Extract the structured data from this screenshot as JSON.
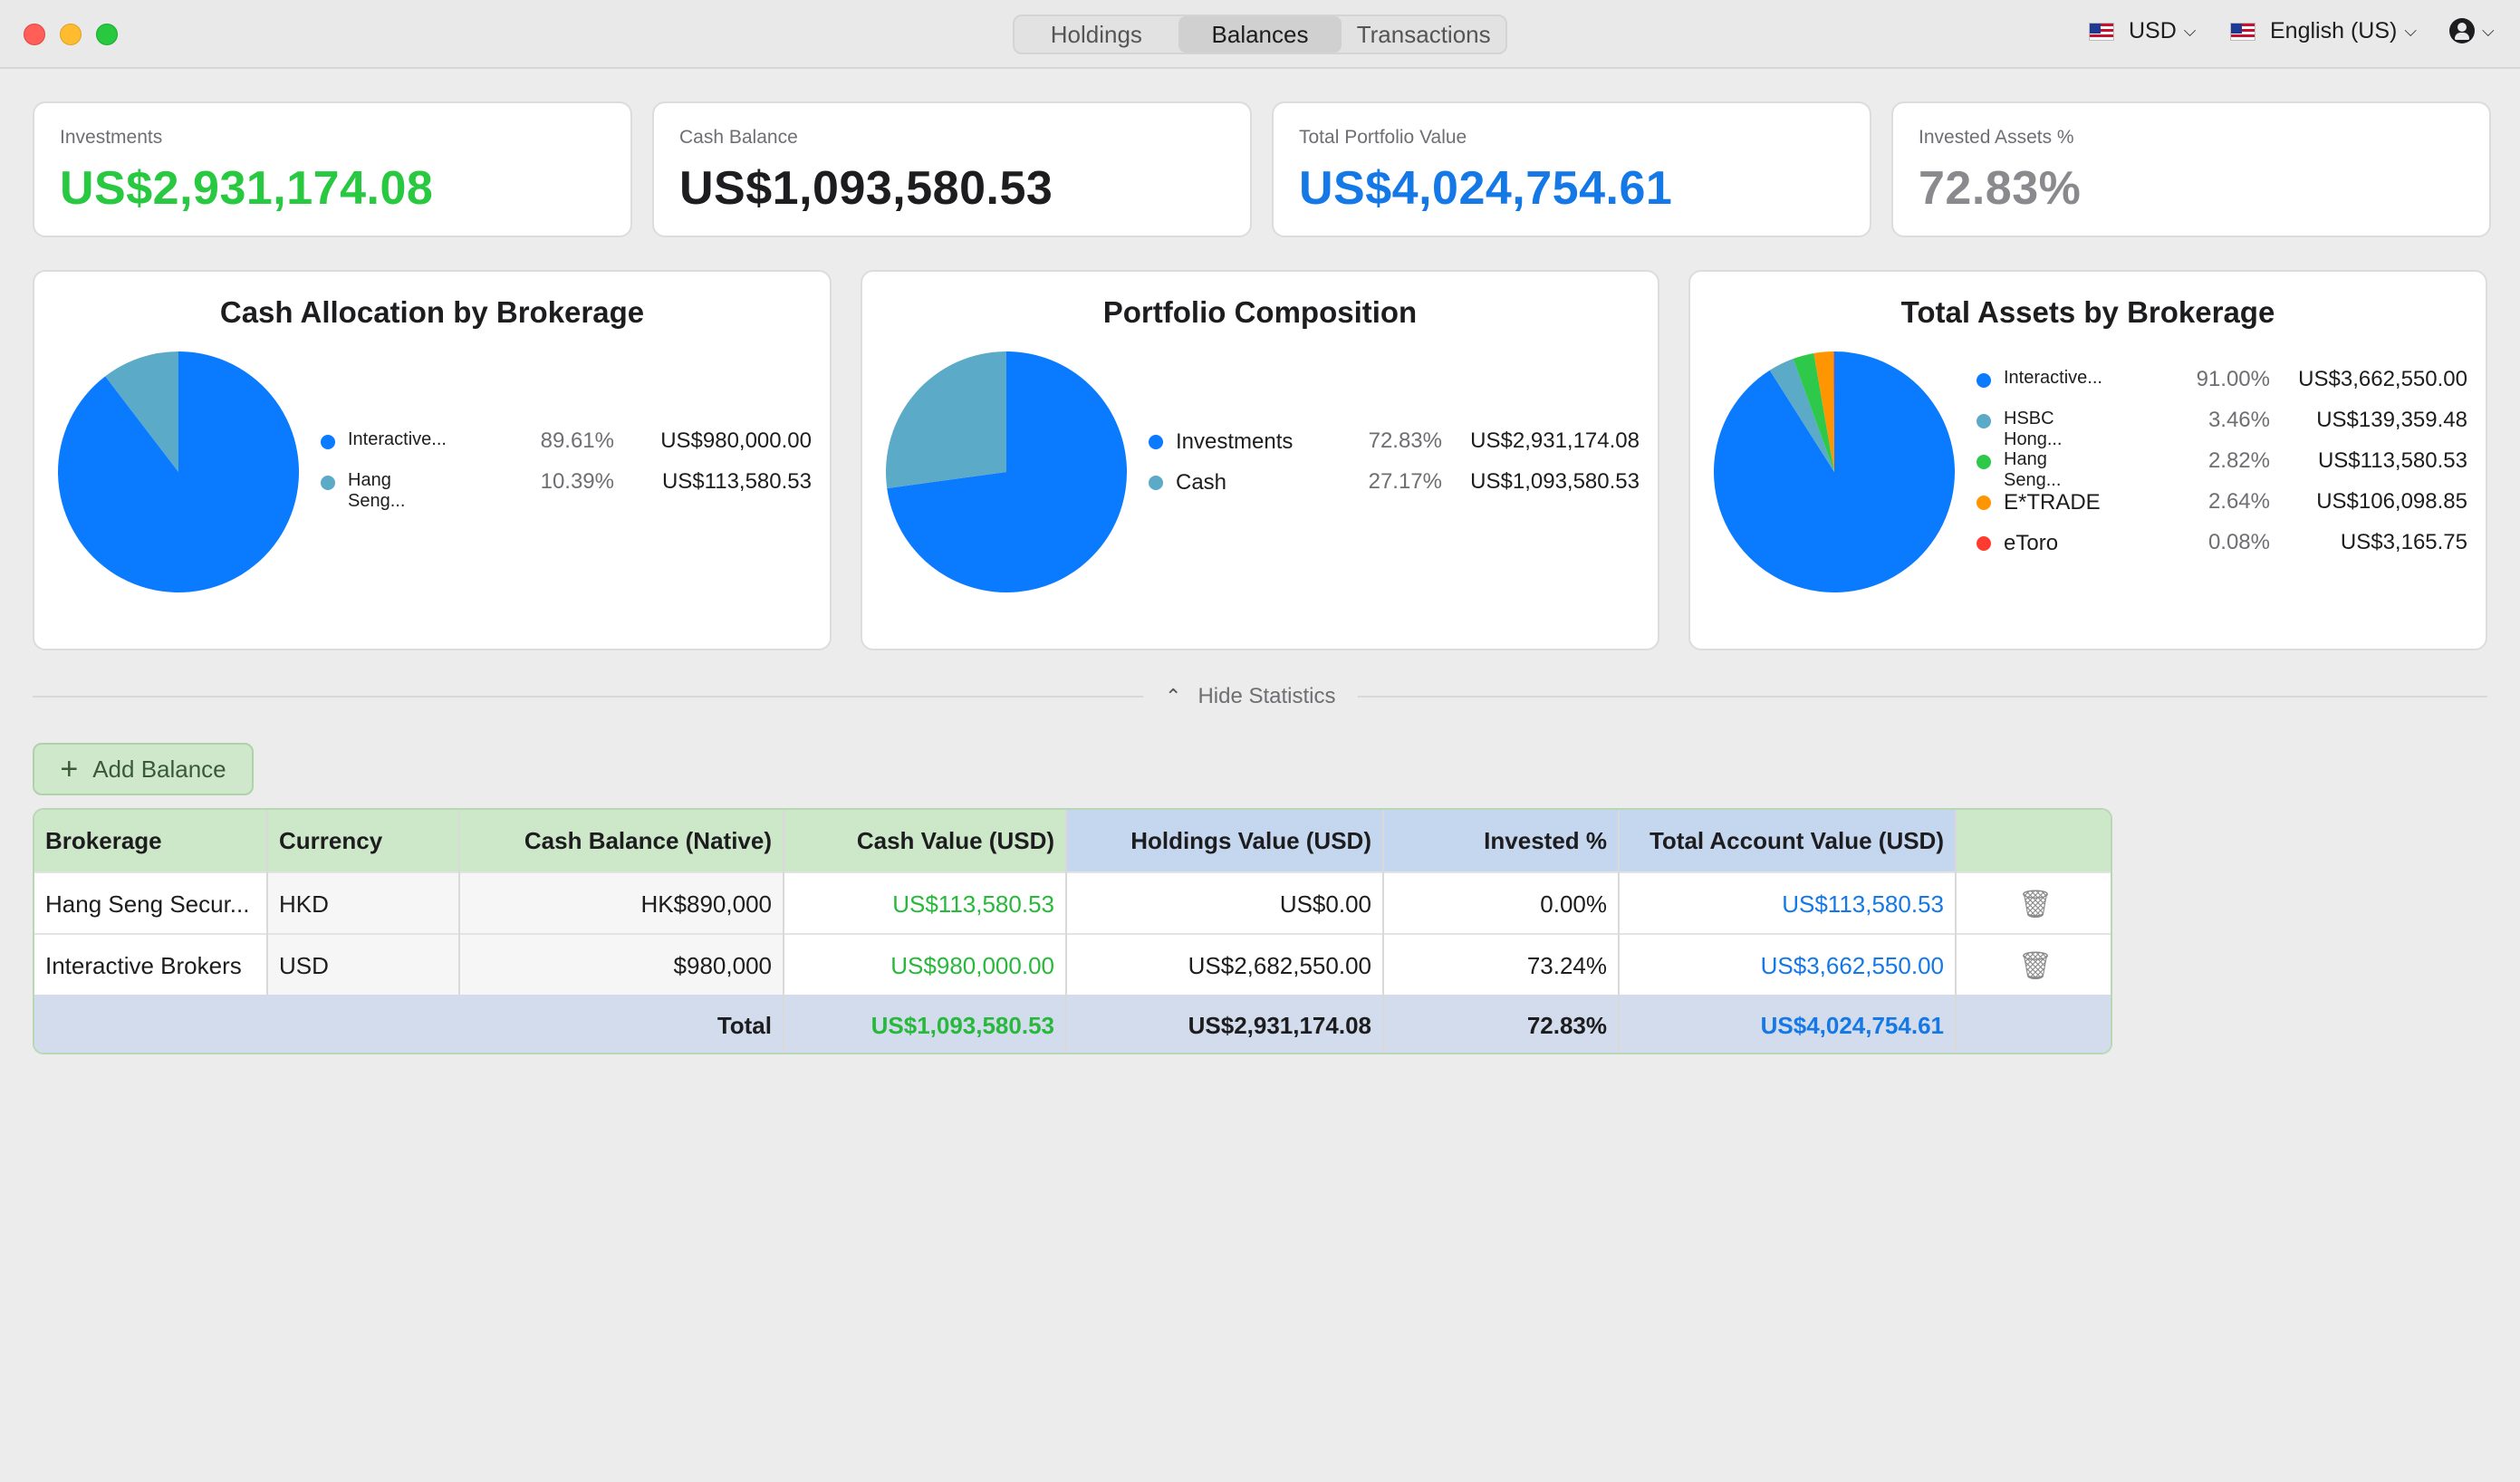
{
  "tabs": [
    {
      "label": "Holdings"
    },
    {
      "label": "Balances"
    },
    {
      "label": "Transactions"
    }
  ],
  "toolbar": {
    "currency": "USD",
    "language": "English (US)"
  },
  "kpis": [
    {
      "label": "Investments",
      "value": "US$2,931,174.08",
      "color": "#28c840"
    },
    {
      "label": "Cash Balance",
      "value": "US$1,093,580.53",
      "color": "#1d1d1f"
    },
    {
      "label": "Total Portfolio Value",
      "value": "US$4,024,754.61",
      "color": "#1478e6"
    },
    {
      "label": "Invested Assets %",
      "value": "72.83%",
      "color": "#8a8a8e"
    }
  ],
  "chart_data": [
    {
      "type": "pie",
      "title": "Cash Allocation by Brokerage",
      "labels": [
        "Interactive...",
        "Hang Seng..."
      ],
      "percents": [
        89.61,
        10.39
      ],
      "values": [
        "US$980,000.00",
        "US$113,580.53"
      ],
      "colors": [
        "#0a7aff",
        "#5aaac8"
      ]
    },
    {
      "type": "pie",
      "title": "Portfolio Composition",
      "labels": [
        "Investments",
        "Cash"
      ],
      "percents": [
        72.83,
        27.17
      ],
      "values": [
        "US$2,931,174.08",
        "US$1,093,580.53"
      ],
      "colors": [
        "#0a7aff",
        "#5aaac8"
      ]
    },
    {
      "type": "pie",
      "title": "Total Assets by Brokerage",
      "labels": [
        "Interactive...",
        "HSBC Hong...",
        "Hang Seng...",
        "E*TRADE",
        "eToro"
      ],
      "percents": [
        91.0,
        3.46,
        2.82,
        2.64,
        0.08
      ],
      "values": [
        "US$3,662,550.00",
        "US$139,359.48",
        "US$113,580.53",
        "US$106,098.85",
        "US$3,165.75"
      ],
      "colors": [
        "#0a7aff",
        "#5aaac8",
        "#2ec94a",
        "#ff9500",
        "#ff3b30"
      ]
    }
  ],
  "hide_statistics_label": "Hide Statistics",
  "add_balance_label": "Add Balance",
  "table": {
    "headers": [
      "Brokerage",
      "Currency",
      "Cash Balance (Native)",
      "Cash Value (USD)",
      "Holdings Value (USD)",
      "Invested %",
      "Total Account Value (USD)"
    ],
    "rows": [
      [
        "Hang Seng Secur...",
        "HKD",
        "HK$890,000",
        "US$113,580.53",
        "US$0.00",
        "0.00%",
        "US$113,580.53"
      ],
      [
        "Interactive Brokers",
        "USD",
        "$980,000",
        "US$980,000.00",
        "US$2,682,550.00",
        "73.24%",
        "US$3,662,550.00"
      ]
    ],
    "total": {
      "label": "Total",
      "cash_value": "US$1,093,580.53",
      "holdings_value": "US$2,931,174.08",
      "invested_pct": "72.83%",
      "total_value": "US$4,024,754.61"
    }
  }
}
